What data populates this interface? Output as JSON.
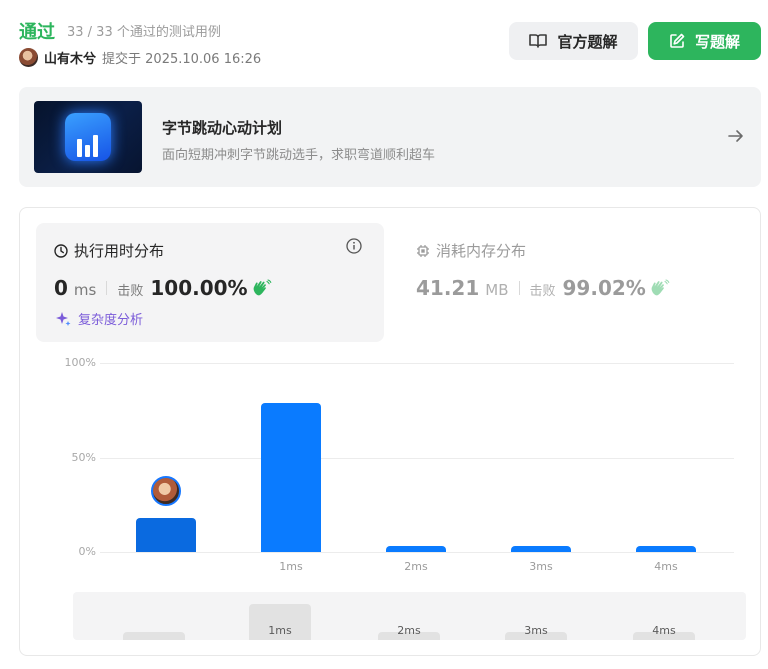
{
  "header": {
    "status": "通过",
    "pass_count": "33 / 33 个通过的测试用例",
    "user_name": "山有木兮",
    "submit_time": "提交于 2025.10.06 16:26",
    "official_solution_label": "官方题解",
    "write_solution_label": "写题解"
  },
  "banner": {
    "title": "字节跳动心动计划",
    "subtitle": "面向短期冲刺字节跳动选手，求职弯道顺利超车"
  },
  "runtime": {
    "title": "执行用时分布",
    "value": "0",
    "unit": "ms",
    "beat_label": "击败",
    "beat_percent": "100.00%",
    "complexity_label": "复杂度分析"
  },
  "memory": {
    "title": "消耗内存分布",
    "value": "41.21",
    "unit": "MB",
    "beat_label": "击败",
    "beat_percent": "99.02%"
  },
  "colors": {
    "accent_green": "#2db55d",
    "bar_blue": "#0a7bff",
    "complexity_purple": "#7b5cd9"
  },
  "chart_data": {
    "type": "bar",
    "categories": [
      "",
      "1ms",
      "2ms",
      "3ms",
      "4ms"
    ],
    "values": [
      18,
      79,
      3,
      3,
      3
    ],
    "ylim": [
      0,
      100
    ],
    "ytick_labels": [
      "100%",
      "50%",
      "0%"
    ],
    "highlight_index": 0,
    "grid": true
  },
  "mini_chart": {
    "labels": [
      "",
      "1ms",
      "2ms",
      "3ms",
      "4ms"
    ],
    "values": [
      18,
      79,
      3,
      3,
      3
    ]
  }
}
